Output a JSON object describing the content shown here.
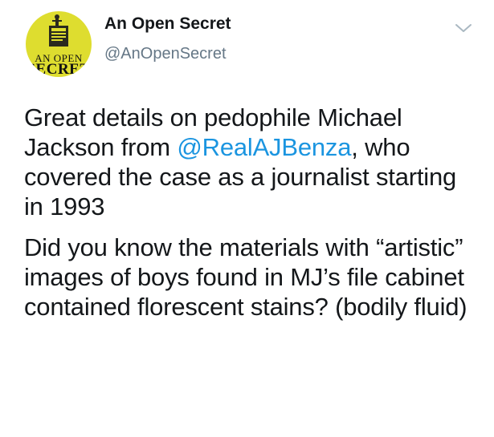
{
  "author": {
    "name": "An Open Secret",
    "handle": "@AnOpenSecret",
    "avatar_text_line1": "AN OPEN",
    "avatar_text_line2": "SECRET"
  },
  "tweet": {
    "paragraph1": {
      "before_mention": "Great details on pedophile Michael Jackson from ",
      "mention": "@RealAJBenza",
      "after_mention": ", who covered the case as a journalist starting in 1993"
    },
    "paragraph2": "Did you know the materials with “artistic” images of boys found in MJ’s file cabinet contained florescent stains? (bodily fluid)"
  },
  "icons": {
    "menu": "chevron-down-icon"
  },
  "colors": {
    "avatar_bg": "#dedd2f",
    "mention": "#1b95e0",
    "handle": "#657786",
    "text": "#14171a"
  }
}
